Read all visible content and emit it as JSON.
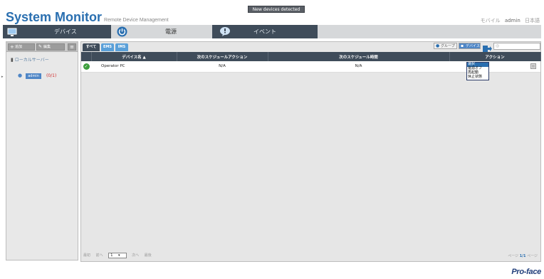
{
  "header": {
    "title": "System Monitor",
    "subtitle": "Remote Device Management",
    "notification": "New devices detected",
    "user_links": [
      "モバイル",
      "admin",
      "日本語"
    ]
  },
  "main_nav": {
    "devices_label": "デバイス",
    "power_label": "電源",
    "events_label": "イベント"
  },
  "sidebar": {
    "add_label": "追加",
    "edit_label": "編集",
    "root_label": "ローカルサーバー",
    "group_name": "admin",
    "group_count": "(0/1)"
  },
  "content": {
    "tabs": [
      "すべて",
      "EMS",
      "IMS"
    ],
    "group_button": "グループ",
    "device_button": "デバイス",
    "columns": [
      "デバイス名 ▲",
      "次のスケジュールアクション",
      "次のスケジュール時間",
      "アクション"
    ],
    "row": {
      "device_name": "Operator PC",
      "next_action": "N/A",
      "next_time": "N/A"
    },
    "action_options": [
      "選択",
      "電源オフ",
      "再起動",
      "休止状態"
    ],
    "pager": {
      "first": "最初",
      "prev": "前へ",
      "page": "1",
      "next": "次へ",
      "last": "最後",
      "page_label": "ページ",
      "page_numbers": "1/1",
      "page_suffix": "ページ"
    }
  },
  "footer": {
    "brand": "Pro-face"
  },
  "colors": {
    "accent": "#2a6fb0",
    "nav_dark": "#3f4c5a",
    "status_ok": "#3c9e3c"
  }
}
